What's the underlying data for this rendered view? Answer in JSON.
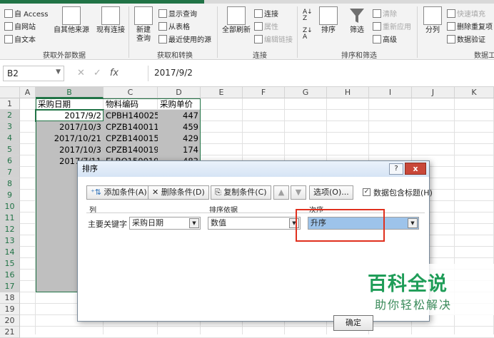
{
  "ribbon": {
    "get_external": {
      "access": "自 Access",
      "web": "自网站",
      "text": "自文本",
      "other_sources": "自其他来源",
      "existing": "现有连接",
      "group": "获取外部数据"
    },
    "get_transform": {
      "new_query": "新建\n查询",
      "show_queries": "显示查询",
      "from_table": "从表格",
      "recent_sources": "最近使用的源",
      "group": "获取和转换"
    },
    "connections": {
      "refresh_all": "全部刷新",
      "connections": "连接",
      "properties": "属性",
      "edit_links": "编辑链接",
      "group": "连接"
    },
    "sort_filter": {
      "sort": "排序",
      "filter": "筛选",
      "clear": "清除",
      "reapply": "重新应用",
      "advanced": "高级",
      "group": "排序和筛选"
    },
    "data_tools": {
      "split": "分列",
      "flash_fill": "快速填充",
      "remove_dup": "删除重复项",
      "validation": "数据验证",
      "group": "数据工"
    }
  },
  "formula_bar": {
    "name_box": "B2",
    "fx": "fx",
    "value": "2017/9/2"
  },
  "columns": [
    "A",
    "B",
    "C",
    "D",
    "E",
    "F",
    "G",
    "H",
    "I",
    "J",
    "K"
  ],
  "rows": [
    "1",
    "2",
    "3",
    "4",
    "5",
    "6",
    "7",
    "8",
    "9",
    "10",
    "11",
    "12",
    "13",
    "14",
    "15",
    "16",
    "17",
    "18",
    "19",
    "20",
    "21"
  ],
  "sheet": {
    "headers": [
      "采购日期",
      "物料编码",
      "采购单价"
    ],
    "rows": [
      [
        "2017/9/2",
        "CPBH140025",
        "447"
      ],
      [
        "2017/10/3",
        "CPZB140011",
        "459"
      ],
      [
        "2017/10/21",
        "CPZB140015",
        "429"
      ],
      [
        "2017/10/3",
        "CPZB140019",
        "174"
      ],
      [
        "2017/7/11",
        "ELBQ150019",
        "483"
      ],
      [
        "20",
        "",
        ""
      ],
      [
        "201",
        "",
        ""
      ],
      [
        "201",
        "",
        ""
      ],
      [
        "2017/",
        "",
        ""
      ],
      [
        "20",
        "",
        ""
      ],
      [
        "20",
        "",
        ""
      ],
      [
        "201",
        "",
        ""
      ],
      [
        "201",
        "",
        ""
      ],
      [
        "201",
        "",
        ""
      ],
      [
        "201",
        "",
        ""
      ],
      [
        "201",
        "",
        ""
      ]
    ]
  },
  "dialog": {
    "title": "排序",
    "help": "?",
    "close": "x",
    "add_level": "添加条件(A)",
    "delete_level": "删除条件(D)",
    "copy_level": "复制条件(C)",
    "move_up": "▲",
    "move_down": "▼",
    "options": "选项(O)...",
    "has_headers": "数据包含标题(H)",
    "has_headers_checked": "✓",
    "col_header": "列",
    "sort_on_header": "排序依据",
    "order_header": "次序",
    "primary_key_label": "主要关键字",
    "column_value": "采购日期",
    "sort_on_value": "数值",
    "order_value": "升序",
    "ok": "确定"
  },
  "watermark": {
    "line1": "百科全说",
    "line2": "助你轻松解决"
  },
  "colors": {
    "excel_green": "#217346",
    "highlight_red": "#e0301e",
    "selected_combo": "#9dc3ea"
  }
}
